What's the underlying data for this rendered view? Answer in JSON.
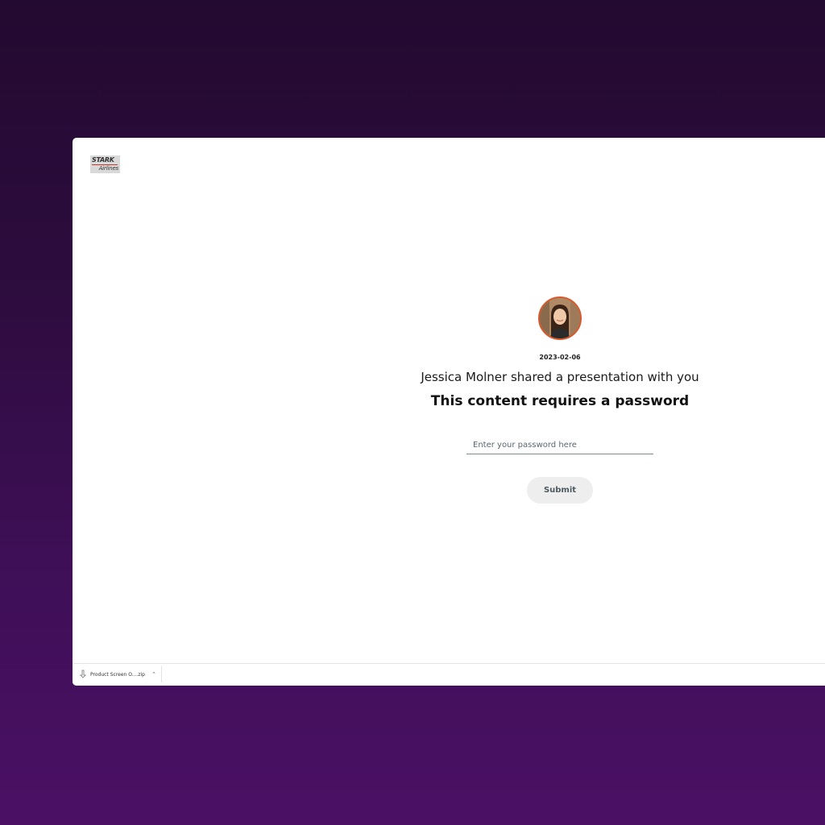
{
  "logo": {
    "top": "STARK",
    "bottom": "Airlines"
  },
  "share": {
    "date": "2023-02-06",
    "message": "Jessica Molner shared a presentation with you",
    "heading": "This content requires a password"
  },
  "password": {
    "placeholder": "Enter your password here",
    "value": ""
  },
  "submit_label": "Submit",
  "download_bar": {
    "file_name": "Product Screen O....zip"
  },
  "colors": {
    "avatar_ring": "#d9582b",
    "background_top": "#230a30",
    "background_bottom": "#4b1064"
  },
  "icons": {
    "file": "file-icon",
    "chevron": "chevron-up-icon"
  }
}
